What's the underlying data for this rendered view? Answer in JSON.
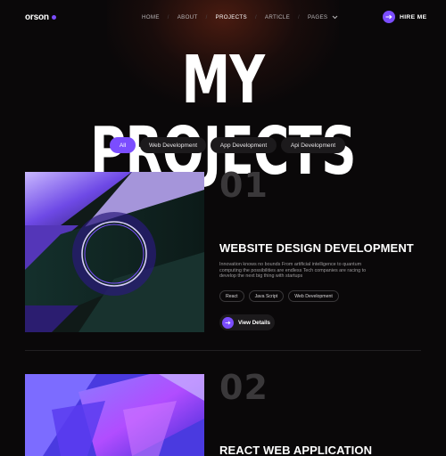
{
  "header": {
    "logo": "orson",
    "menu": [
      {
        "label": "HOME"
      },
      {
        "label": "ABOUT"
      },
      {
        "label": "PROJECTS"
      },
      {
        "label": "ARTICLE"
      },
      {
        "label": "PAGES"
      }
    ],
    "active_item": "PROJECTS",
    "hire_label": "HIRE ME"
  },
  "page_title": "MY PROJECTS",
  "filters": [
    {
      "label": "All",
      "active": true
    },
    {
      "label": "Web Development",
      "active": false
    },
    {
      "label": "App Development",
      "active": false
    },
    {
      "label": "Api Development",
      "active": false
    }
  ],
  "projects": [
    {
      "number": "01",
      "title": "WEBSITE DESIGN DEVELOPMENT",
      "description": "Innovation knows no bounds From artificial intelligence to quantum computing the possibilities are endless Tech companies are racing to develop the next big thing with startups",
      "tags": [
        "React",
        "Java Script",
        "Web Development"
      ],
      "button_label": "View Details"
    },
    {
      "number": "02",
      "title": "REACT WEB APPLICATION"
    }
  ],
  "colors": {
    "accent": "#7b4dff",
    "background": "#0a0809",
    "chip_bg": "#1c1a1c",
    "number_gray": "#3a383a"
  },
  "icons": {
    "hire": "arrow-right-icon",
    "details": "arrow-right-icon",
    "pages": "chevron-down-icon"
  }
}
